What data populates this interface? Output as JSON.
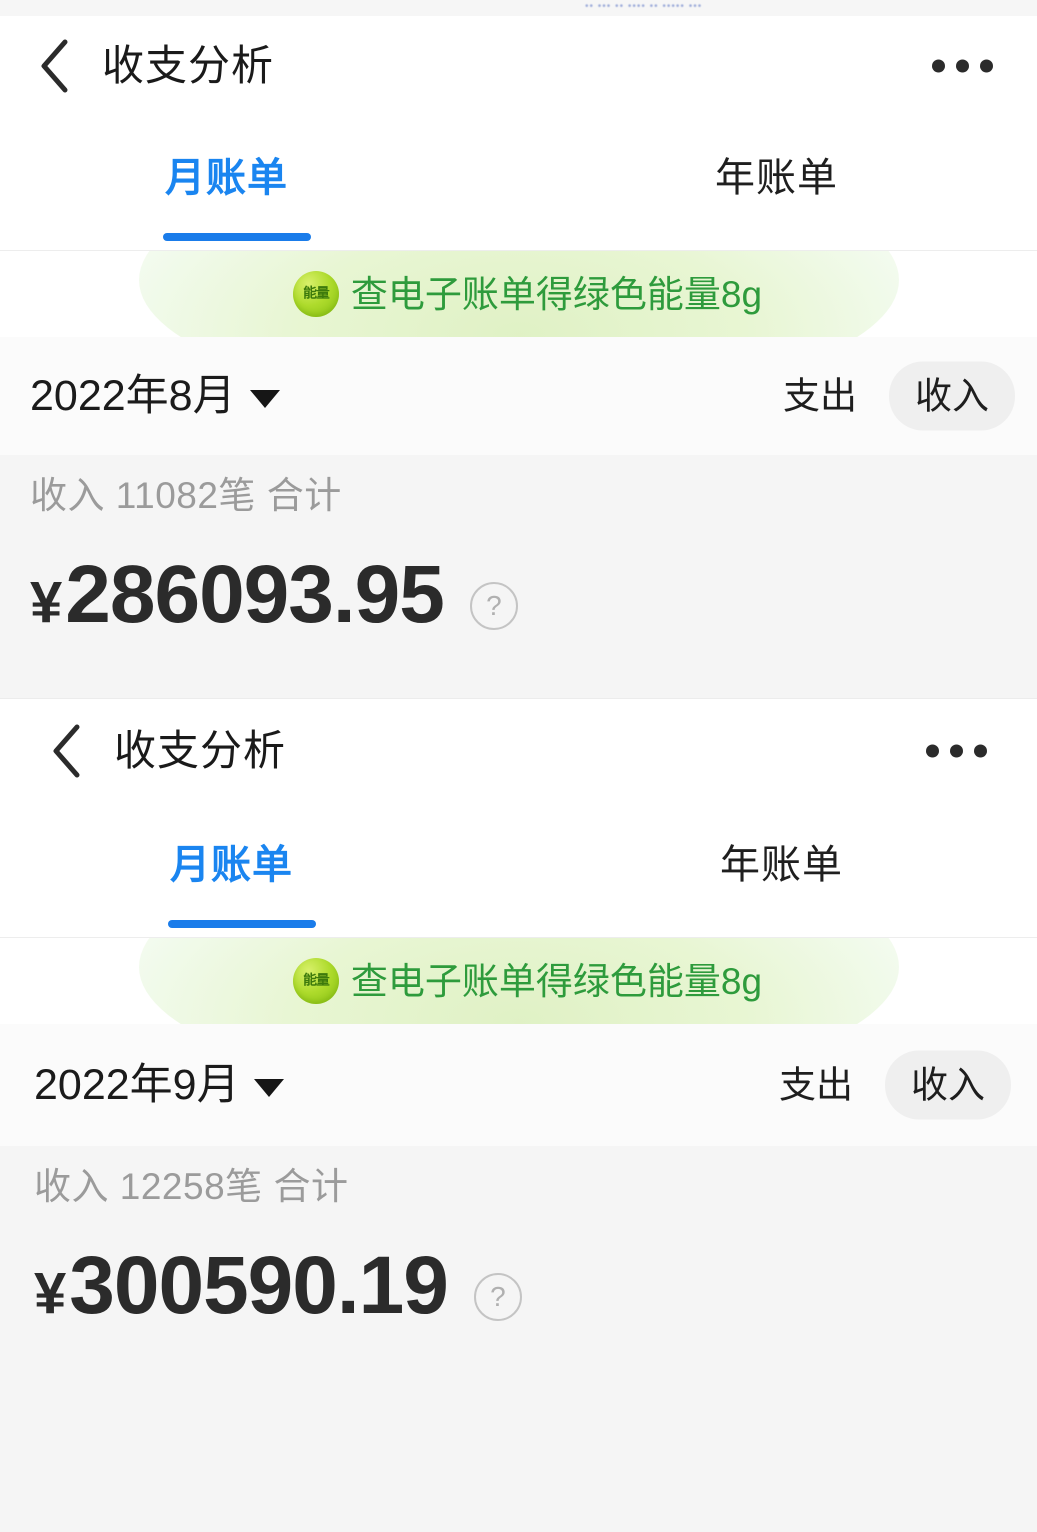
{
  "top_strip": {
    "ghost_text": "•• ••• •• •••• •• ••••• •••"
  },
  "colors": {
    "accent_blue": "#1A85F0",
    "underline_blue": "#1A7CEA",
    "energy_green": "#2E9B3C",
    "badge_green": "#AEDB2C",
    "card_gray": "#F5F5F5",
    "muted_text": "#9B9B9B",
    "amount_text": "#2B2B2B"
  },
  "screens": [
    {
      "navbar": {
        "back_icon": "chevron-left-icon",
        "title": "收支分析",
        "more_icon": "more-horizontal-icon"
      },
      "tabs": [
        {
          "label": "月账单",
          "active": true
        },
        {
          "label": "年账单",
          "active": false
        }
      ],
      "energy_banner": {
        "badge_icon": "energy-badge-icon",
        "badge_label": "能量",
        "text": "查电子账单得绿色能量8g"
      },
      "period": {
        "label": "2022年8月",
        "caret_icon": "chevron-down-icon"
      },
      "type_toggle": [
        {
          "label": "支出",
          "selected": false
        },
        {
          "label": "收入",
          "selected": true
        }
      ],
      "summary": {
        "caption": "收入 11082笔 合计",
        "currency_symbol": "¥",
        "amount": "286093.95",
        "help_icon": "question-mark-icon",
        "help_label": "?"
      }
    },
    {
      "navbar": {
        "back_icon": "chevron-left-icon",
        "title": "收支分析",
        "more_icon": "more-horizontal-icon"
      },
      "tabs": [
        {
          "label": "月账单",
          "active": true
        },
        {
          "label": "年账单",
          "active": false
        }
      ],
      "energy_banner": {
        "badge_icon": "energy-badge-icon",
        "badge_label": "能量",
        "text": "查电子账单得绿色能量8g"
      },
      "period": {
        "label": "2022年9月",
        "caret_icon": "chevron-down-icon"
      },
      "type_toggle": [
        {
          "label": "支出",
          "selected": false
        },
        {
          "label": "收入",
          "selected": true
        }
      ],
      "summary": {
        "caption": "收入 12258笔 合计",
        "currency_symbol": "¥",
        "amount": "300590.19",
        "help_icon": "question-mark-icon",
        "help_label": "?"
      }
    }
  ]
}
